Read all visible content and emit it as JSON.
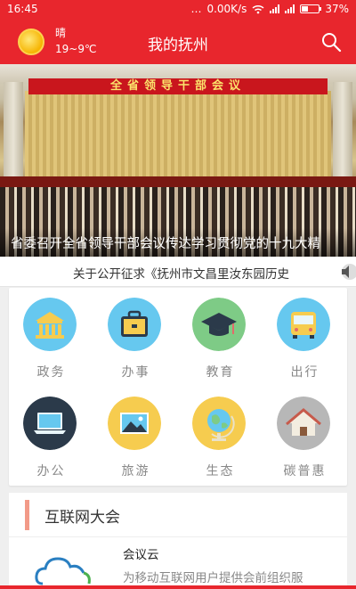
{
  "status_bar": {
    "time": "16:45",
    "network_speed": "0.00K/s",
    "battery": "37%",
    "battery_level": 0.37
  },
  "header": {
    "weather_condition": "晴",
    "temperature": "19~9℃",
    "title": "我的抚州",
    "search_icon": "search-icon"
  },
  "banner": {
    "sign_text": "全省领导干部会议",
    "caption": "省委召开全省领导干部会议传达学习贯彻党的十九大精"
  },
  "notice": {
    "text": "关于公开征求《抚州市文昌里汝东园历史",
    "icon": "speaker-icon"
  },
  "services": [
    {
      "label": "政务",
      "icon": "government-building-icon",
      "color": "#66c8ef"
    },
    {
      "label": "办事",
      "icon": "briefcase-icon",
      "color": "#66c8ef"
    },
    {
      "label": "教育",
      "icon": "graduation-cap-icon",
      "color": "#7ecb86"
    },
    {
      "label": "出行",
      "icon": "bus-icon",
      "color": "#66c8ef"
    },
    {
      "label": "办公",
      "icon": "laptop-icon",
      "color": "#2b3a4a"
    },
    {
      "label": "旅游",
      "icon": "landscape-photo-icon",
      "color": "#f6cc4f"
    },
    {
      "label": "生态",
      "icon": "globe-icon",
      "color": "#f6cc4f"
    },
    {
      "label": "碳普惠",
      "icon": "house-icon",
      "color": "#b7b7b7"
    }
  ],
  "section": {
    "title": "互联网大会",
    "item_title": "会议云",
    "item_desc": "为移动互联网用户提供会前组织服"
  }
}
